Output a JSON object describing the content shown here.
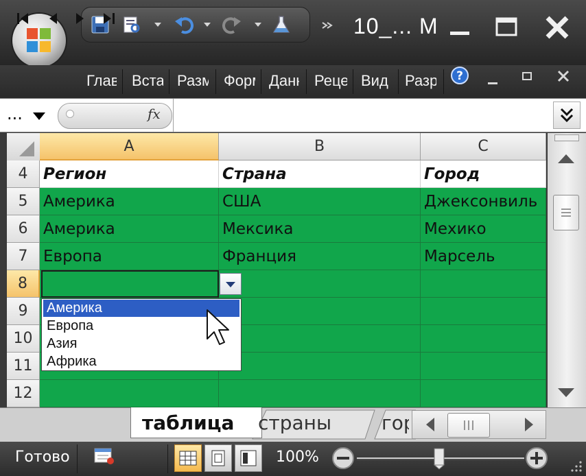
{
  "window": {
    "title": "10_... M"
  },
  "ribbon": {
    "tabs": [
      "Главная",
      "Вставка",
      "Разметка страницы",
      "Формулы",
      "Данные",
      "Рецензирование",
      "Вид",
      "Разработчик"
    ]
  },
  "formula_bar": {
    "name_box": "...",
    "fx_label": "fx",
    "value": ""
  },
  "columns": [
    "A",
    "B",
    "C"
  ],
  "rows": [
    {
      "num": "4",
      "cells": [
        "Регион",
        "Страна",
        "Город"
      ]
    },
    {
      "num": "5",
      "cells": [
        "Америка",
        "США",
        "Джексонвиль"
      ]
    },
    {
      "num": "6",
      "cells": [
        "Америка",
        "Мексика",
        "Мехико"
      ]
    },
    {
      "num": "7",
      "cells": [
        "Европа",
        "Франция",
        "Марсель"
      ]
    },
    {
      "num": "8",
      "cells": [
        "",
        "",
        ""
      ]
    },
    {
      "num": "9",
      "cells": [
        "",
        "",
        ""
      ]
    },
    {
      "num": "10",
      "cells": [
        "",
        "",
        ""
      ]
    },
    {
      "num": "11",
      "cells": [
        "",
        "",
        ""
      ]
    },
    {
      "num": "12",
      "cells": [
        "",
        "",
        ""
      ]
    }
  ],
  "dropdown": {
    "options": [
      "Америка",
      "Европа",
      "Азия",
      "Африка"
    ],
    "highlighted": "Америка"
  },
  "sheets": {
    "active": "таблица",
    "second": "страны",
    "third": "города"
  },
  "status": {
    "ready": "Готово",
    "zoom": "100%"
  },
  "colors": {
    "cell_fill": "#11a64b",
    "selection_header": "#f5c36b",
    "list_highlight": "#2d5ec4"
  }
}
